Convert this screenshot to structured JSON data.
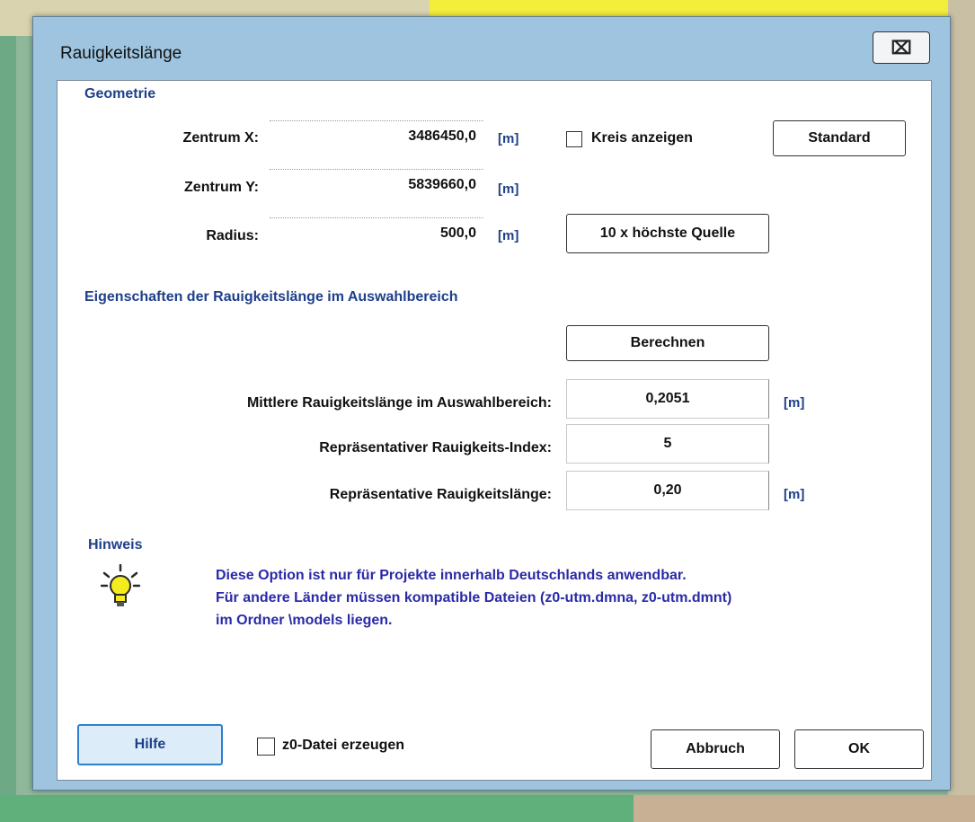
{
  "window": {
    "title": "Rauigkeitslänge",
    "close_glyph": "⌧"
  },
  "geometry": {
    "section_title": "Geometrie",
    "center_x_label": "Zentrum X:",
    "center_x_value": "3486450,0",
    "center_y_label": "Zentrum Y:",
    "center_y_value": "5839660,0",
    "radius_label": "Radius:",
    "radius_value": "500,0",
    "unit": "[m]",
    "show_circle_label": "Kreis anzeigen",
    "standard_button": "Standard",
    "highest_source_button": "10 x höchste Quelle"
  },
  "properties": {
    "section_title": "Eigenschaften der Rauigkeitslänge im Auswahlbereich",
    "calculate_button": "Berechnen",
    "mean_label": "Mittlere Rauigkeitslänge im Auswahlbereich:",
    "mean_value": "0,2051",
    "index_label": "Repräsentativer Rauigkeits-Index:",
    "index_value": "5",
    "rep_label": "Repräsentative Rauigkeitslänge:",
    "rep_value": "0,20",
    "unit": "[m]"
  },
  "hint": {
    "title": "Hinweis",
    "icon": "lightbulb-icon",
    "line1": "Diese Option ist nur für Projekte innerhalb Deutschlands anwendbar.",
    "line2": "Für andere Länder müssen kompatible Dateien (z0-utm.dmna, z0-utm.dmnt)",
    "line3": "im Ordner \\models liegen."
  },
  "footer": {
    "help_button": "Hilfe",
    "z0_file_label": "z0-Datei erzeugen",
    "cancel_button": "Abbruch",
    "ok_button": "OK"
  },
  "colors": {
    "accent_blue": "#2f7fcf",
    "label_blue": "#1e3f8a",
    "hint_text": "#2a2aa8",
    "window_frame": "#9ec4df"
  }
}
